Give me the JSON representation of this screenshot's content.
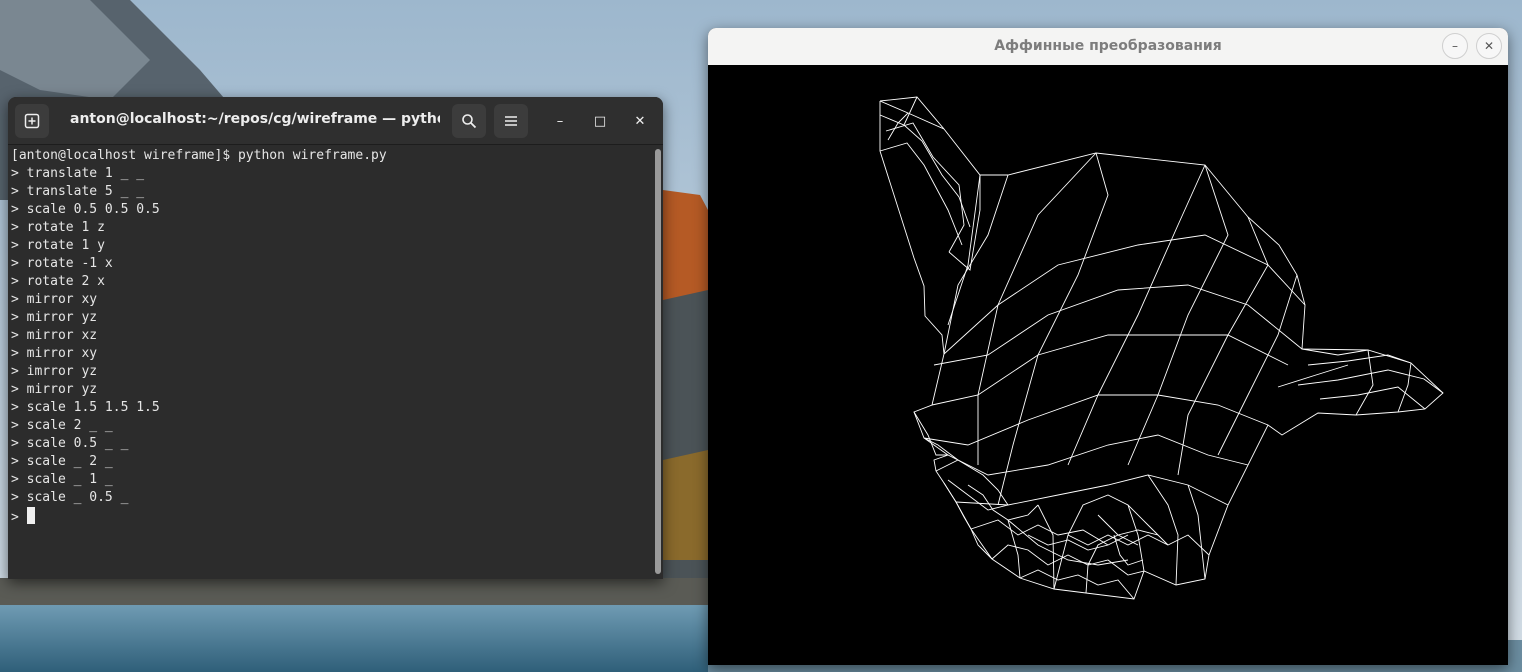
{
  "terminal": {
    "title": "anton@localhost:~/repos/cg/wireframe — python wi…",
    "new_tab_icon": "new-tab-icon",
    "search_icon": "search-icon",
    "menu_icon": "hamburger-menu-icon",
    "minimize_glyph": "–",
    "maximize_glyph": "□",
    "close_glyph": "✕",
    "lines": [
      "[anton@localhost wireframe]$ python wireframe.py",
      "> translate 1 _ _",
      "> translate 5 _ _",
      "> scale 0.5 0.5 0.5",
      "> rotate 1 z",
      "> rotate 1 y",
      "> rotate -1 x",
      "> rotate 2 x",
      "> mirror xy",
      "> mirror yz",
      "> mirror xz",
      "> mirror xy",
      "> imrror yz",
      "> mirror yz",
      "> scale 1.5 1.5 1.5",
      "> scale 2 _ _",
      "> scale 0.5 _ _",
      "> scale _ 2 _",
      "> scale _ 1 _",
      "> scale _ 0.5 _"
    ],
    "prompt": "> "
  },
  "viewer": {
    "title": "Аффинные преобразования",
    "minimize_glyph": "–",
    "close_glyph": "✕",
    "canvas_bg": "#000000",
    "line_color": "#ffffff"
  }
}
